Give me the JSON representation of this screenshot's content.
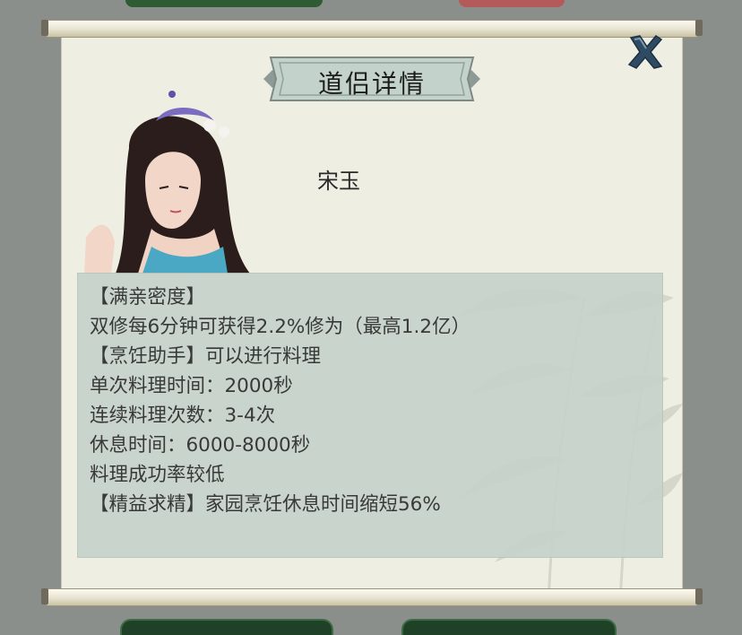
{
  "dialog": {
    "title": "道侣详情",
    "character_name": "宋玉",
    "close_icon": "close-x-icon"
  },
  "details": {
    "lines": [
      "【满亲密度】",
      "双修每6分钟可获得2.2%修为（最高1.2亿）",
      "【烹饪助手】可以进行料理",
      "单次料理时间：2000秒",
      "连续料理次数：3-4次",
      "休息时间：6000-8000秒",
      "料理成功率较低",
      "【精益求精】家园烹饪休息时间缩短56%"
    ]
  },
  "colors": {
    "scroll_paper": "#efeee2",
    "title_banner": "#c3d2cb",
    "detail_panel": "#c6d3cb",
    "close_icon": "#2f4b63",
    "text": "#2a2a2a"
  }
}
